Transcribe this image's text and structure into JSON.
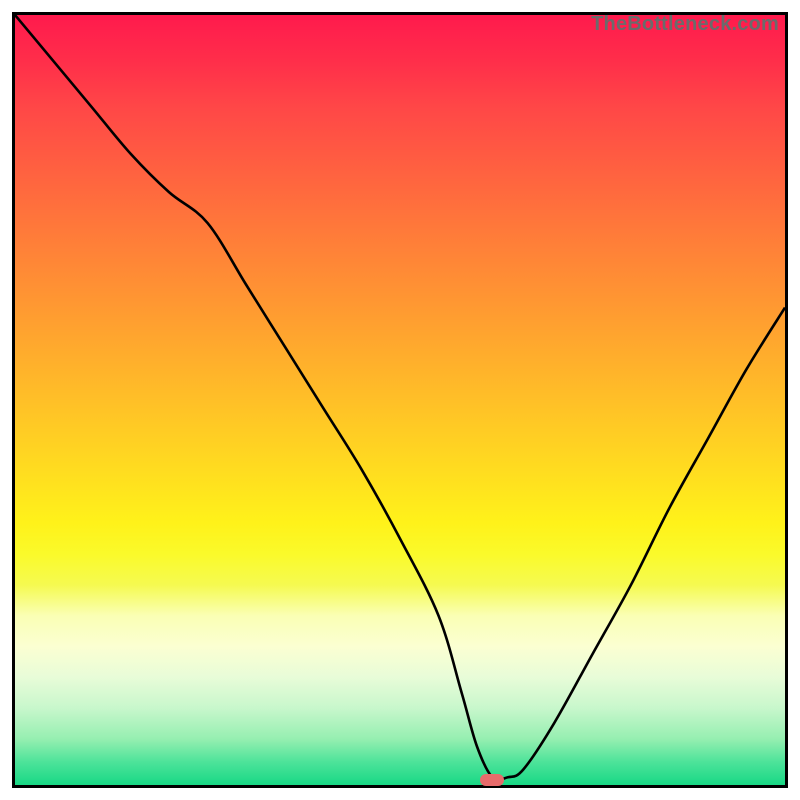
{
  "watermark": "TheBottleneck.com",
  "marker": {
    "x_pct": 62.0,
    "y_pct": 99.3,
    "color": "#e76b6b"
  },
  "chart_data": {
    "type": "line",
    "title": "",
    "xlabel": "",
    "ylabel": "",
    "xlim": [
      0,
      100
    ],
    "ylim": [
      0,
      100
    ],
    "grid": false,
    "legend": false,
    "annotations": [
      "TheBottleneck.com"
    ],
    "series": [
      {
        "name": "bottleneck-curve",
        "x": [
          0,
          5,
          10,
          15,
          20,
          25,
          30,
          35,
          40,
          45,
          50,
          55,
          58,
          60,
          62,
          64,
          66,
          70,
          75,
          80,
          85,
          90,
          95,
          100
        ],
        "y": [
          100,
          94,
          88,
          82,
          77,
          73,
          65,
          57,
          49,
          41,
          32,
          22,
          12,
          5,
          1,
          1,
          2,
          8,
          17,
          26,
          36,
          45,
          54,
          62
        ]
      }
    ],
    "background_gradient": {
      "direction": "vertical",
      "stops": [
        {
          "pos": 0.0,
          "color": "#ff1a4d"
        },
        {
          "pos": 0.3,
          "color": "#ff8038"
        },
        {
          "pos": 0.55,
          "color": "#ffcc24"
        },
        {
          "pos": 0.72,
          "color": "#fafa2a"
        },
        {
          "pos": 0.85,
          "color": "#e8fcd8"
        },
        {
          "pos": 1.0,
          "color": "#18d885"
        }
      ]
    },
    "minimum_marker": {
      "x": 62,
      "y": 0.7,
      "color": "#e76b6b"
    }
  }
}
